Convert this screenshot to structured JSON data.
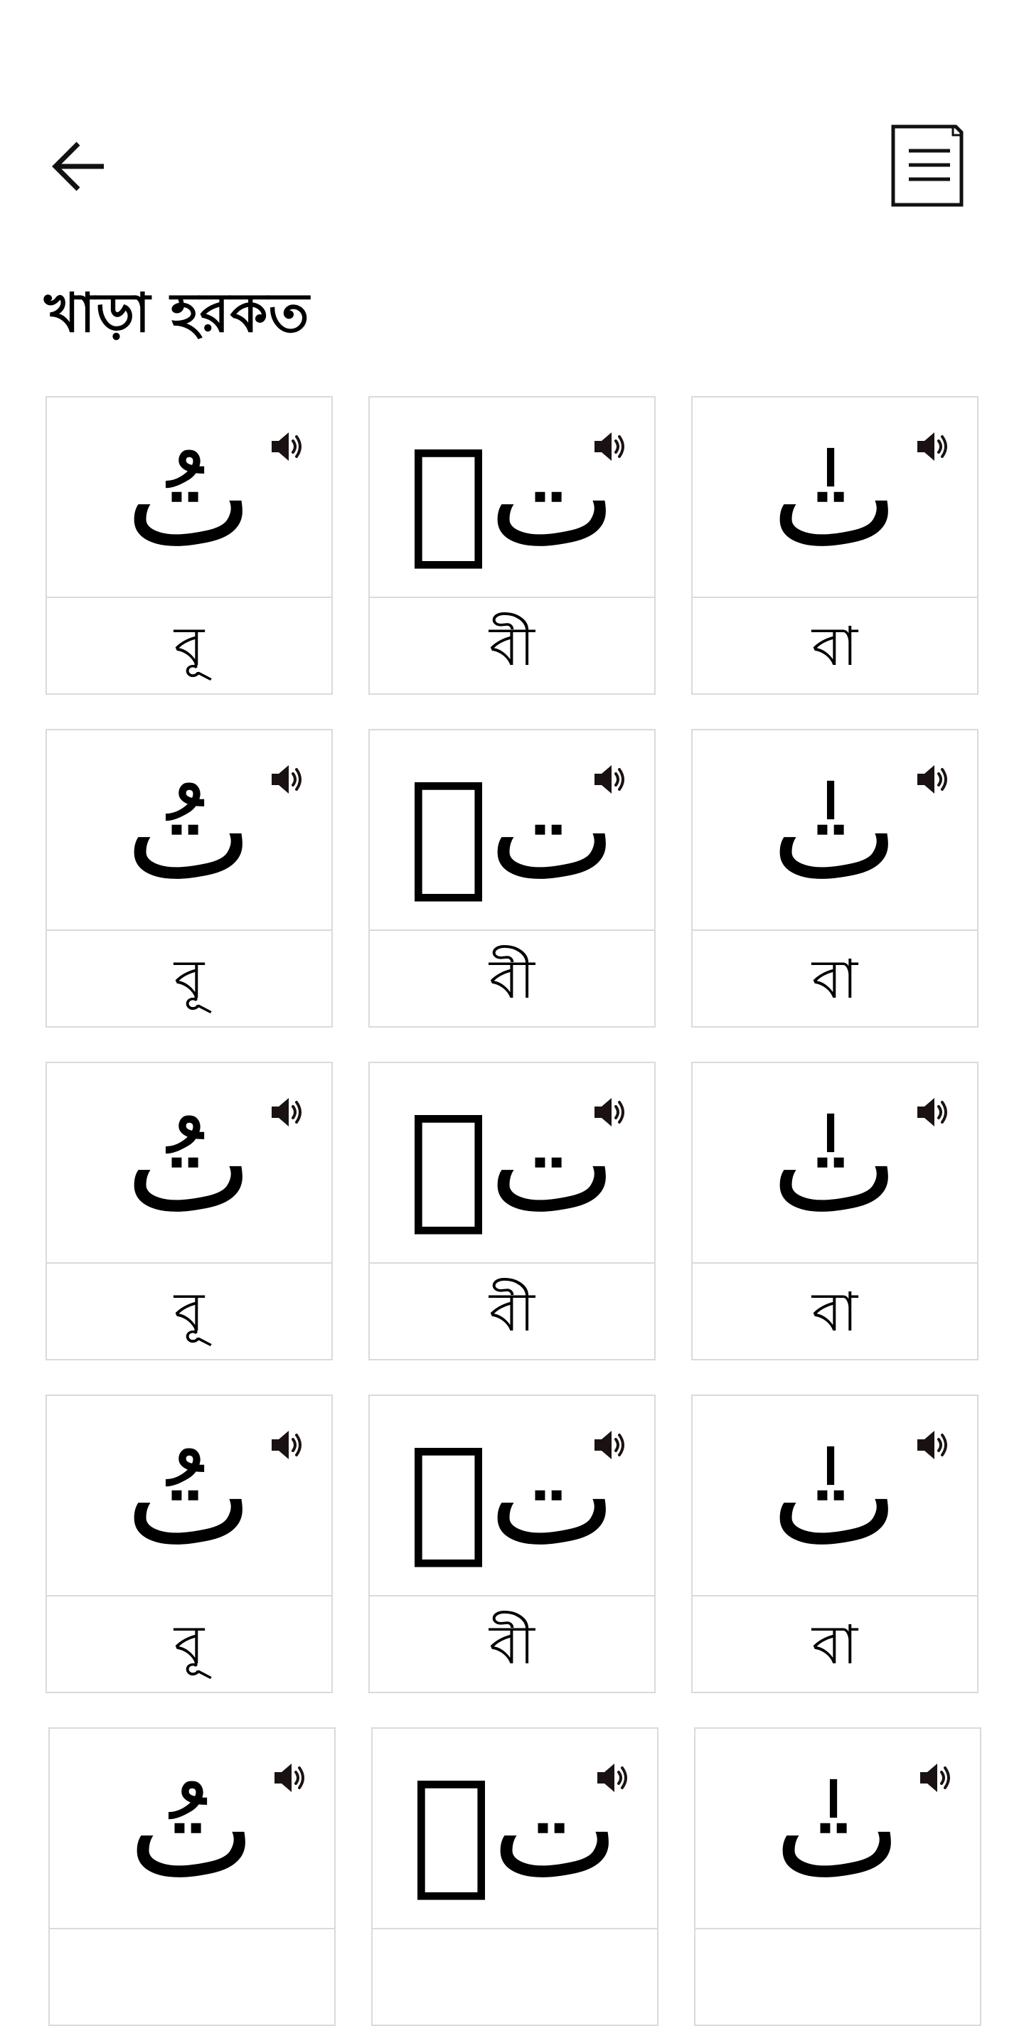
{
  "header": {
    "back_icon": "arrow-left-icon",
    "document_icon": "document-list-icon"
  },
  "title": "খাড়া হরকত",
  "cards": [
    {
      "arabic": "تُ",
      "bengali": "বূ",
      "sound_icon": "speaker-icon"
    },
    {
      "arabic": "تٖ",
      "bengali": "বী",
      "sound_icon": "speaker-icon"
    },
    {
      "arabic": "تٰ",
      "bengali": "বা",
      "sound_icon": "speaker-icon"
    },
    {
      "arabic": "تُ",
      "bengali": "বূ",
      "sound_icon": "speaker-icon"
    },
    {
      "arabic": "تٖ",
      "bengali": "বী",
      "sound_icon": "speaker-icon"
    },
    {
      "arabic": "تٰ",
      "bengali": "বা",
      "sound_icon": "speaker-icon"
    },
    {
      "arabic": "تُ",
      "bengali": "বূ",
      "sound_icon": "speaker-icon"
    },
    {
      "arabic": "تٖ",
      "bengali": "বী",
      "sound_icon": "speaker-icon"
    },
    {
      "arabic": "تٰ",
      "bengali": "বা",
      "sound_icon": "speaker-icon"
    },
    {
      "arabic": "تُ",
      "bengali": "বূ",
      "sound_icon": "speaker-icon"
    },
    {
      "arabic": "تٖ",
      "bengali": "বী",
      "sound_icon": "speaker-icon"
    },
    {
      "arabic": "تٰ",
      "bengali": "বা",
      "sound_icon": "speaker-icon"
    },
    {
      "arabic": "تُ",
      "bengali": "",
      "sound_icon": "speaker-icon"
    },
    {
      "arabic": "تٖ",
      "bengali": "",
      "sound_icon": "speaker-icon"
    },
    {
      "arabic": "تٰ",
      "bengali": "",
      "sound_icon": "speaker-icon"
    }
  ]
}
